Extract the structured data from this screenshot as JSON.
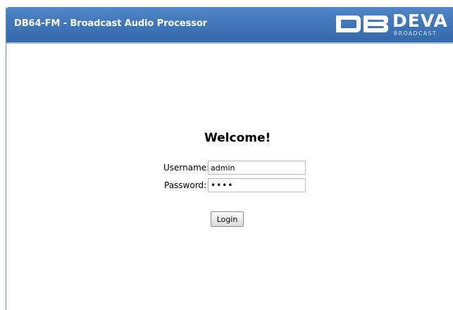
{
  "header": {
    "app_title": "DB64-FM - Broadcast Audio Processor",
    "logo_text": "DEVA",
    "logo_subtext": "BROADCAST",
    "logo_icon": "db-logo-icon"
  },
  "login": {
    "heading": "Welcome!",
    "username_label": "Username:",
    "username_value": "admin",
    "password_label": "Password:",
    "password_value": "••••",
    "login_button_label": "Login"
  },
  "colors": {
    "header_bg": "#3f74b6",
    "header_text": "#ffffff",
    "page_bg": "#ffffff"
  }
}
